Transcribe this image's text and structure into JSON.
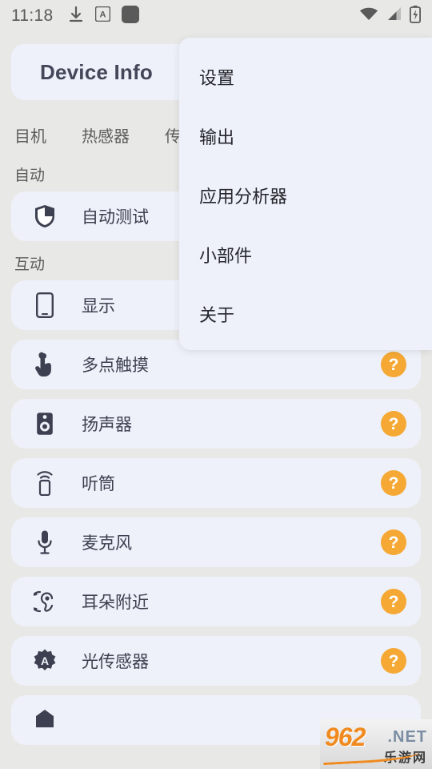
{
  "status_bar": {
    "time": "11:18",
    "left_icons": [
      "download-icon",
      "input-method-a-icon",
      "rounded-square-icon"
    ],
    "right_icons": [
      "wifi-icon",
      "cellular-signal-icon",
      "battery-charging-icon"
    ]
  },
  "header": {
    "title": "Device Info"
  },
  "tabs": [
    {
      "label": "目机"
    },
    {
      "label": "热感器"
    },
    {
      "label": "传"
    }
  ],
  "fab": {
    "name": "blue-action-button",
    "color": "#1a6fc4"
  },
  "sections": [
    {
      "label": "自动",
      "items": [
        {
          "label": "自动测试",
          "icon": "shield-icon",
          "badge": null
        }
      ]
    },
    {
      "label": "互动",
      "items": [
        {
          "label": "显示",
          "icon": "phone-screen-icon",
          "badge": null
        },
        {
          "label": "多点触摸",
          "icon": "touch-hand-icon",
          "badge": "?"
        },
        {
          "label": "扬声器",
          "icon": "speaker-icon",
          "badge": "?"
        },
        {
          "label": "听筒",
          "icon": "earpiece-icon",
          "badge": "?"
        },
        {
          "label": "麦克风",
          "icon": "microphone-icon",
          "badge": "?"
        },
        {
          "label": "耳朵附近",
          "icon": "proximity-ear-icon",
          "badge": "?"
        },
        {
          "label": "光传感器",
          "icon": "light-sensor-icon",
          "badge": "?"
        }
      ]
    }
  ],
  "menu": {
    "items": [
      {
        "label": "设置"
      },
      {
        "label": "输出"
      },
      {
        "label": "应用分析器"
      },
      {
        "label": "小部件"
      },
      {
        "label": "关于"
      }
    ]
  },
  "watermark": {
    "main": "962",
    "net": ".NET",
    "cn": "乐游网"
  },
  "colors": {
    "background": "#e8e8e6",
    "card": "#eef1f9",
    "accent_blue": "#1a6fc4",
    "badge_orange": "#f5a834",
    "text_dark": "#3d4050"
  }
}
